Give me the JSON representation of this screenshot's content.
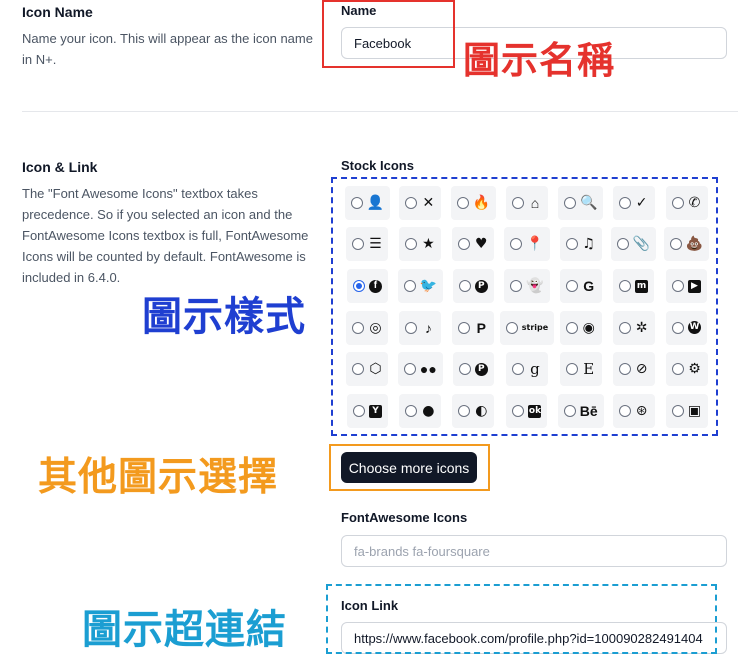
{
  "icon_name_section": {
    "title": "Icon Name",
    "description": "Name your icon. This will appear as the icon name in N+.",
    "field_label": "Name",
    "field_value": "Facebook"
  },
  "icon_link_section": {
    "title": "Icon & Link",
    "description": "The \"Font Awesome Icons\" textbox takes precedence. So if you selected an icon and the FontAwesome Icons textbox is full, FontAwesome Icons will be counted by default. FontAwesome is included in 6.4.0.",
    "stock_icons_label": "Stock Icons",
    "choose_more_button": "Choose more icons",
    "fontawesome_label": "FontAwesome Icons",
    "fontawesome_placeholder": "fa-brands fa-foursquare",
    "icon_link_label": "Icon Link",
    "icon_link_value": "https://www.facebook.com/profile.php?id=100090282491404"
  },
  "stock_icons": [
    {
      "name": "user-icon",
      "glyph": "👤",
      "style": "",
      "selected": false
    },
    {
      "name": "x-mark-icon",
      "glyph": "✕",
      "style": "",
      "selected": false
    },
    {
      "name": "fire-icon",
      "glyph": "🔥",
      "style": "",
      "selected": false
    },
    {
      "name": "house-icon",
      "glyph": "⌂",
      "style": "bold",
      "selected": false
    },
    {
      "name": "magnifying-glass-icon",
      "glyph": "🔍",
      "style": "",
      "selected": false
    },
    {
      "name": "check-icon",
      "glyph": "✓",
      "style": "",
      "selected": false
    },
    {
      "name": "phone-icon",
      "glyph": "✆",
      "style": "",
      "selected": false
    },
    {
      "name": "bars-icon",
      "glyph": "☰",
      "style": "",
      "selected": false
    },
    {
      "name": "star-icon",
      "glyph": "★",
      "style": "",
      "selected": false
    },
    {
      "name": "heart-icon",
      "glyph": "♥",
      "style": "",
      "selected": false
    },
    {
      "name": "location-pin-icon",
      "glyph": "📍",
      "style": "",
      "selected": false
    },
    {
      "name": "music-icon",
      "glyph": "♫",
      "style": "",
      "selected": false
    },
    {
      "name": "paperclip-icon",
      "glyph": "📎",
      "style": "",
      "selected": false
    },
    {
      "name": "poo-icon",
      "glyph": "💩",
      "style": "",
      "selected": false
    },
    {
      "name": "facebook-icon",
      "glyph": "f",
      "style": "fb",
      "selected": true
    },
    {
      "name": "twitter-icon",
      "glyph": "🐦",
      "style": "",
      "selected": false
    },
    {
      "name": "pinterest-icon",
      "glyph": "P",
      "style": "dark-circle",
      "selected": false
    },
    {
      "name": "snapchat-icon",
      "glyph": "👻",
      "style": "",
      "selected": false
    },
    {
      "name": "google-icon",
      "glyph": "G",
      "style": "bold",
      "selected": false
    },
    {
      "name": "mastodon-icon",
      "glyph": "m",
      "style": "dark-square",
      "selected": false
    },
    {
      "name": "youtube-icon",
      "glyph": "▶",
      "style": "dark-square",
      "selected": false
    },
    {
      "name": "instagram-icon",
      "glyph": "◎",
      "style": "",
      "selected": false
    },
    {
      "name": "tiktok-icon",
      "glyph": "♪",
      "style": "bold",
      "selected": false
    },
    {
      "name": "paypal-icon",
      "glyph": "P",
      "style": "bold",
      "selected": false
    },
    {
      "name": "stripe-icon",
      "glyph": "stripe",
      "style": "small",
      "selected": false
    },
    {
      "name": "discord-icon",
      "glyph": "◉",
      "style": "",
      "selected": false
    },
    {
      "name": "slack-icon",
      "glyph": "✲",
      "style": "",
      "selected": false
    },
    {
      "name": "wordpress-icon",
      "glyph": "W",
      "style": "dark-circle",
      "selected": false
    },
    {
      "name": "codepen-icon",
      "glyph": "⬡",
      "style": "",
      "selected": false
    },
    {
      "name": "medium-icon",
      "glyph": "●●",
      "style": "bold",
      "selected": false
    },
    {
      "name": "product-hunt-icon",
      "glyph": "P",
      "style": "dark-circle",
      "selected": false
    },
    {
      "name": "goodreads-icon",
      "glyph": "g",
      "style": "serif",
      "selected": false
    },
    {
      "name": "etsy-icon",
      "glyph": "E",
      "style": "serif",
      "selected": false
    },
    {
      "name": "safari-compass-icon",
      "glyph": "⊘",
      "style": "",
      "selected": false
    },
    {
      "name": "steam-icon",
      "glyph": "⚙",
      "style": "",
      "selected": false
    },
    {
      "name": "y-combinator-icon",
      "glyph": "Y",
      "style": "dark-square",
      "selected": false
    },
    {
      "name": "reddit-icon",
      "glyph": "●",
      "style": "",
      "selected": false
    },
    {
      "name": "github-icon",
      "glyph": "◐",
      "style": "",
      "selected": false
    },
    {
      "name": "odnoklassniki-icon",
      "glyph": "ok",
      "style": "dark-square",
      "selected": false
    },
    {
      "name": "behance-icon",
      "glyph": "Bē",
      "style": "bold",
      "selected": false
    },
    {
      "name": "dribbble-icon",
      "glyph": "⊛",
      "style": "",
      "selected": false
    },
    {
      "name": "twitch-icon",
      "glyph": "▣",
      "style": "",
      "selected": false
    }
  ],
  "annotations": {
    "name_label": "圖示名稱",
    "style_label": "圖示樣式",
    "more_label": "其他圖示選擇",
    "link_label": "圖示超連結",
    "colors": {
      "red": "#e5322d",
      "blue": "#1f3fd1",
      "orange": "#f39a1e",
      "cyan": "#1b9ed2"
    }
  }
}
